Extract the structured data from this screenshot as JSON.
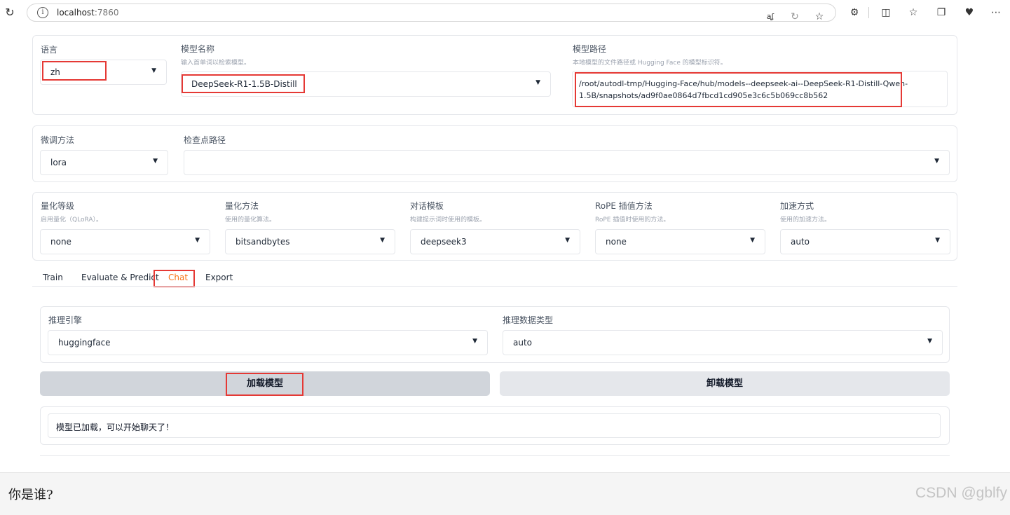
{
  "browser": {
    "host": "localhost",
    "port": ":7860",
    "icons": [
      "reload-icon",
      "site-info-icon",
      "read-aloud-icon",
      "reading-view-icon",
      "favorite-icon",
      "extensions-icon",
      "split-screen-icon",
      "favorites-bar-icon",
      "collections-icon",
      "performance-icon",
      "more-icon"
    ]
  },
  "model": {
    "language_label": "语言",
    "language_value": "zh",
    "name_label": "模型名称",
    "name_hint": "输入首单词以检索模型。",
    "name_value": "DeepSeek-R1-1.5B-Distill",
    "path_label": "模型路径",
    "path_hint": "本地模型的文件路径或 Hugging Face 的模型标识符。",
    "path_value": "/root/autodl-tmp/Hugging-Face/hub/models--deepseek-ai--DeepSeek-R1-Distill-Qwen-1.5B/snapshots/ad9f0ae0864d7fbcd1cd905e3c6c5b069cc8b562"
  },
  "finetune": {
    "method_label": "微调方法",
    "method_value": "lora",
    "checkpoint_label": "检查点路径",
    "checkpoint_value": ""
  },
  "advanced": {
    "quant_bit_label": "量化等级",
    "quant_bit_hint": "启用量化（QLoRA）。",
    "quant_bit_value": "none",
    "quant_method_label": "量化方法",
    "quant_method_hint": "使用的量化算法。",
    "quant_method_value": "bitsandbytes",
    "template_label": "对话模板",
    "template_hint": "构建提示词时使用的模板。",
    "template_value": "deepseek3",
    "rope_label": "RoPE 插值方法",
    "rope_hint": "RoPE 插值时使用的方法。",
    "rope_value": "none",
    "booster_label": "加速方式",
    "booster_hint": "使用的加速方法。",
    "booster_value": "auto"
  },
  "tabs": [
    {
      "label": "Train"
    },
    {
      "label": "Evaluate & Predict"
    },
    {
      "label": "Chat"
    },
    {
      "label": "Export"
    }
  ],
  "chat": {
    "infer_backend_label": "推理引擎",
    "infer_backend_value": "huggingface",
    "infer_dtype_label": "推理数据类型",
    "infer_dtype_value": "auto",
    "load_button": "加载模型",
    "unload_button": "卸载模型",
    "status_text": "模型已加载，可以开始聊天了！"
  },
  "input": {
    "query_text": "你是谁?"
  },
  "watermark": "CSDN @gblfy",
  "colors": {
    "accent": "#f97316",
    "highlight_box": "#e53935"
  }
}
